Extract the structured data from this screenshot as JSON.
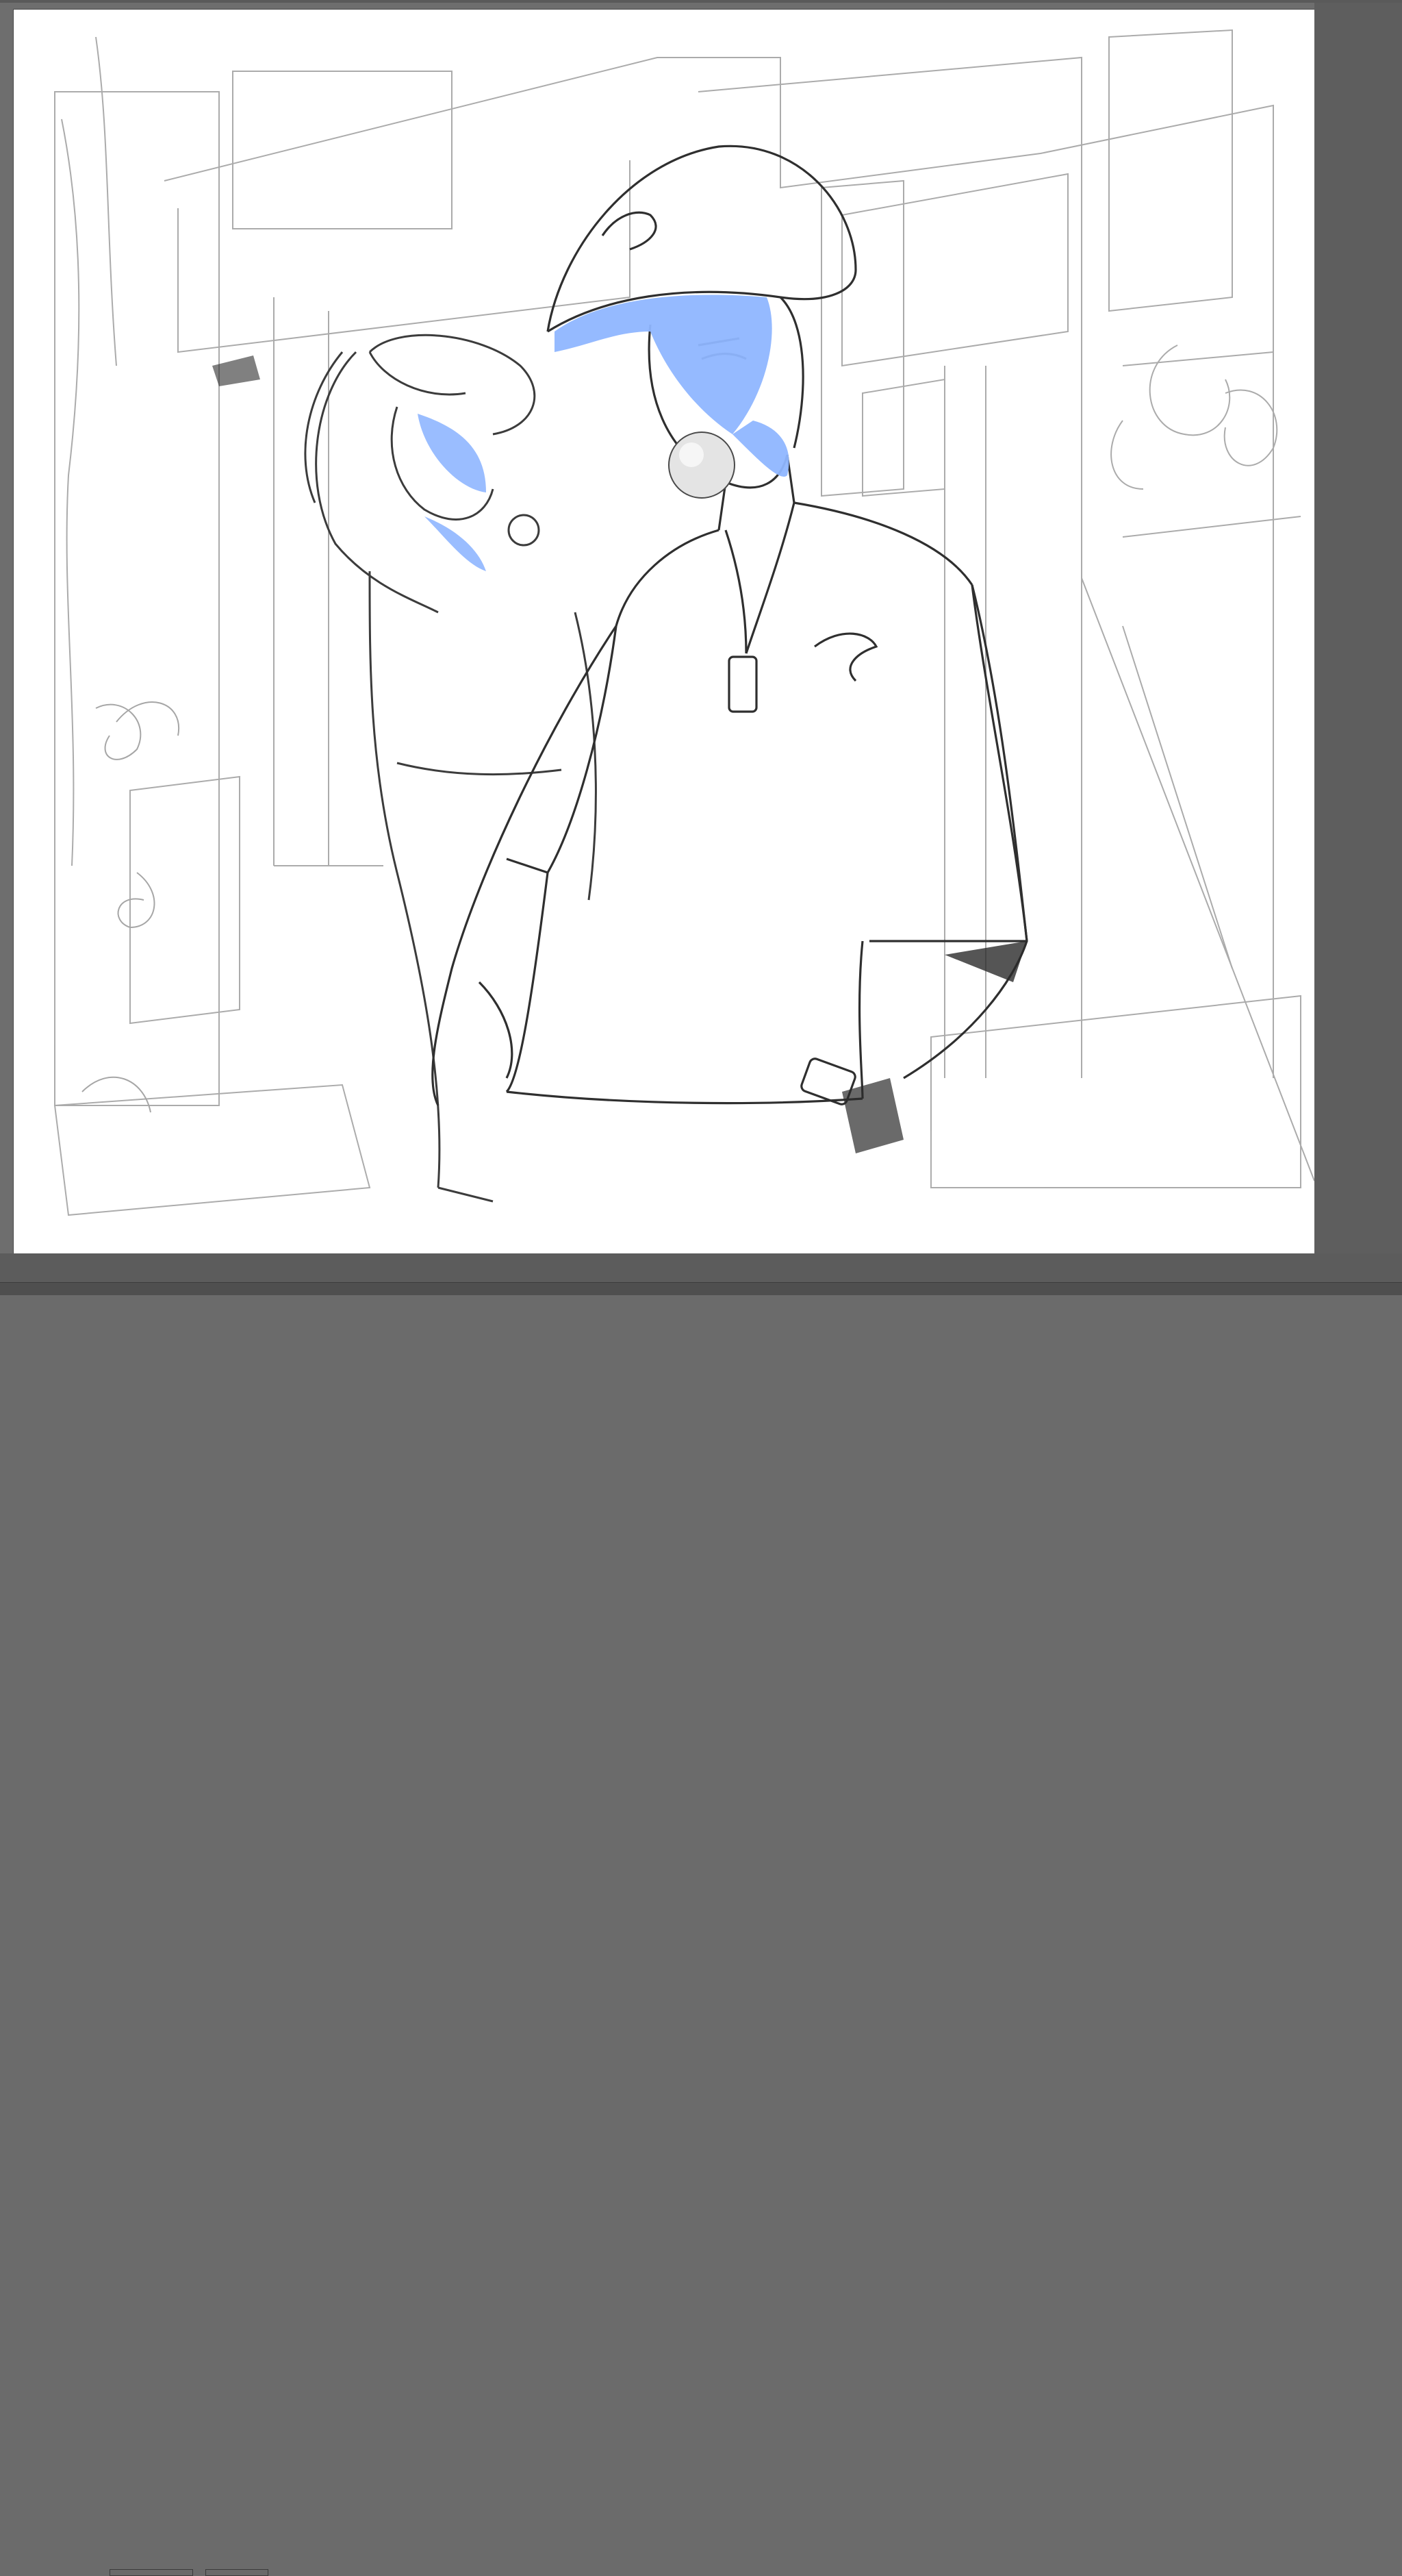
{
  "app": {
    "name": "",
    "document": {
      "has_visible_text": false
    }
  },
  "canvas": {
    "background_color": "#ffffff",
    "line_color": "#3a3a3a",
    "sketch_gray": "#9a9a9a",
    "shadow_fill_color": "#8fb6ff",
    "workspace_color": "#6e6e6e"
  },
  "ui": {
    "scrollbar_bottom": "bottom-scroll",
    "scrollbar_right": "right-scroll"
  }
}
